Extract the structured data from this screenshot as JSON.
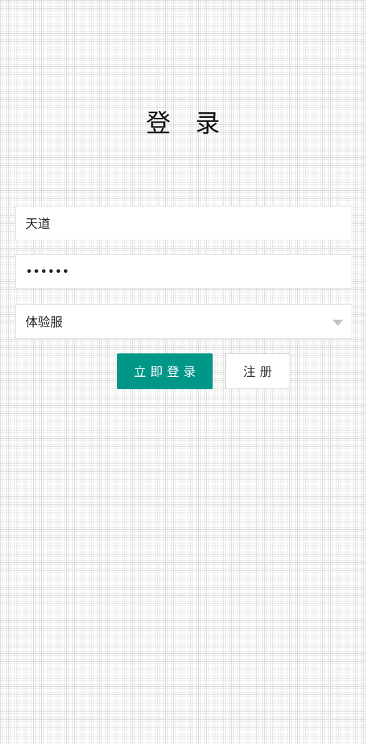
{
  "page": {
    "title": "登 录"
  },
  "form": {
    "username_value": "天道",
    "password_value": "••••••",
    "server_selected": "体验服"
  },
  "buttons": {
    "login_label": "立即登录",
    "register_label": "注册"
  },
  "colors": {
    "primary": "#009688",
    "background": "#ffffff",
    "border": "#e6e6e6"
  },
  "icons": {
    "dropdown": "caret-down-icon"
  }
}
